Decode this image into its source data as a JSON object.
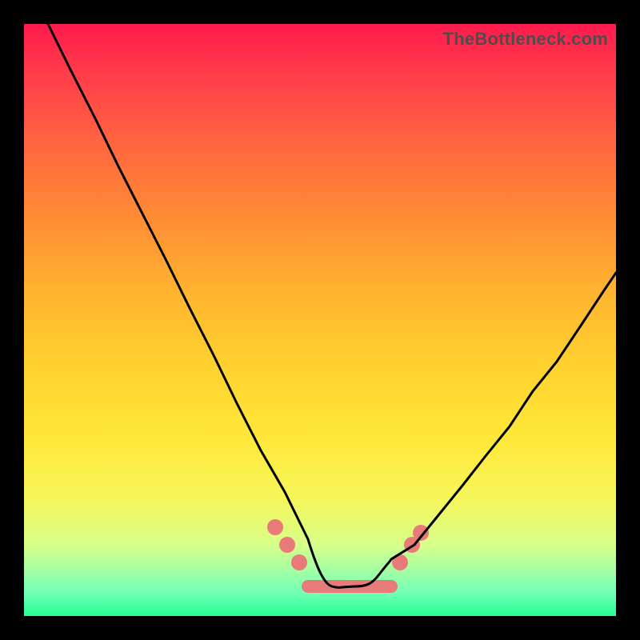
{
  "watermark": "TheBottleneck.com",
  "colors": {
    "frame": "#000000",
    "gradient_top": "#ff1a4d",
    "gradient_bottom": "#25ff91",
    "curve": "#000000",
    "floor_marker": "#e87a7a",
    "watermark_text": "#4d4d4d"
  },
  "chart_data": {
    "type": "line",
    "title": "",
    "xlabel": "",
    "ylabel": "",
    "xlim": [
      0,
      100
    ],
    "ylim": [
      0,
      100
    ],
    "legend": false,
    "grid": false,
    "series": [
      {
        "name": "bottleneck-curve",
        "x": [
          4,
          8,
          12,
          16,
          20,
          24,
          28,
          32,
          36,
          40,
          44,
          48,
          50,
          52,
          54,
          56,
          58,
          60,
          62,
          66,
          70,
          74,
          78,
          82,
          86,
          90,
          94,
          98,
          100
        ],
        "values": [
          100,
          92,
          84,
          76,
          68,
          60,
          52,
          44,
          36,
          28,
          21,
          13,
          9,
          6,
          5,
          5,
          5,
          6,
          8,
          12,
          17,
          22,
          27,
          32,
          38,
          43,
          49,
          55,
          58
        ]
      }
    ],
    "annotations": [
      {
        "name": "floor-highlight",
        "kind": "segment",
        "x_range": [
          48,
          62
        ],
        "y": 5,
        "color": "#e87a7a",
        "note": "thick salmon band with beads marking the curve minimum"
      }
    ],
    "beads": {
      "left": {
        "x": [
          42.5,
          44.5,
          46.5
        ],
        "y": [
          15,
          12,
          9
        ]
      },
      "right": {
        "x": [
          63.5,
          65.5,
          67.0
        ],
        "y": [
          9,
          12,
          14
        ]
      }
    }
  }
}
